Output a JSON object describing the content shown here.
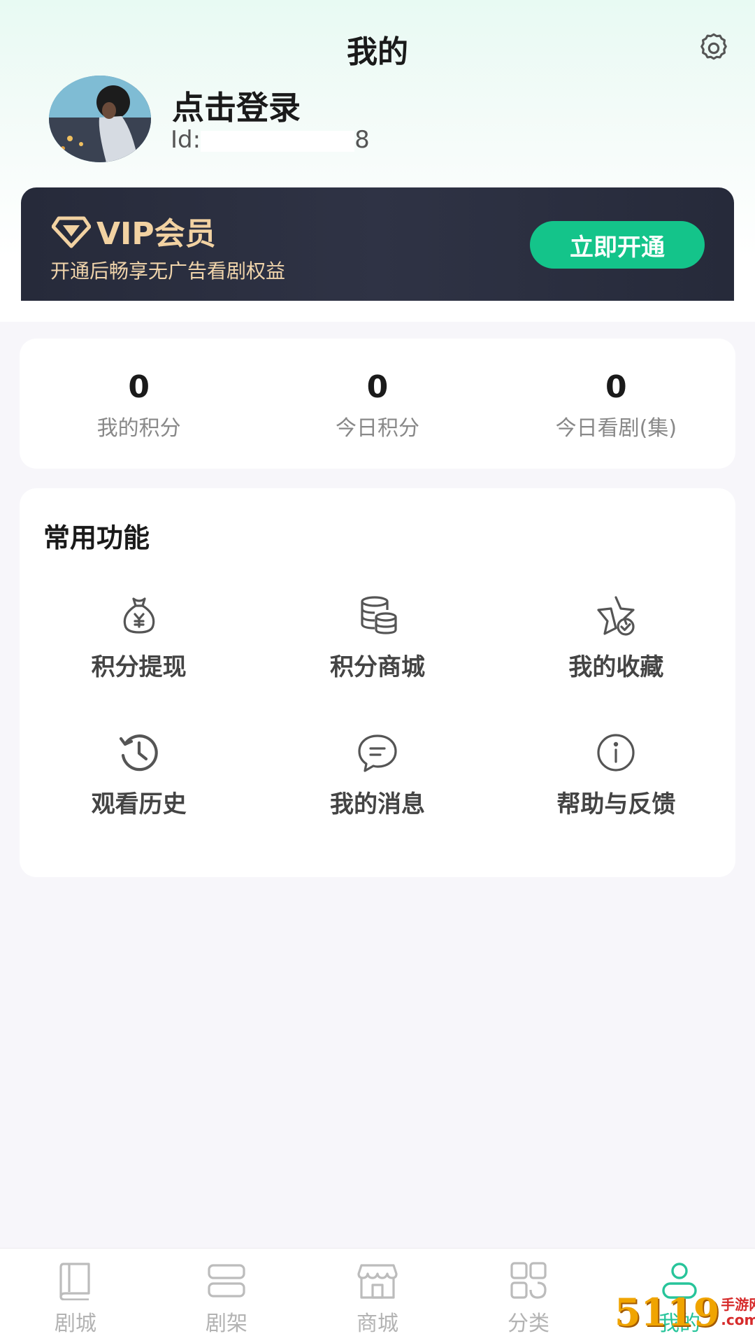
{
  "header": {
    "title": "我的",
    "settings_icon": "gear-icon"
  },
  "profile": {
    "login_text": "点击登录",
    "id_prefix": "Id:",
    "id_suffix": "8"
  },
  "vip": {
    "title": "VIP会员",
    "description": "开通后畅享无广告看剧权益",
    "button": "立即开通",
    "accent": "#14c48a"
  },
  "stats": [
    {
      "value": "0",
      "label": "我的积分"
    },
    {
      "value": "0",
      "label": "今日积分"
    },
    {
      "value": "0",
      "label": "今日看剧(集)"
    }
  ],
  "functions": {
    "title": "常用功能",
    "items": [
      {
        "label": "积分提现",
        "icon": "money-bag-icon"
      },
      {
        "label": "积分商城",
        "icon": "coins-stack-icon"
      },
      {
        "label": "我的收藏",
        "icon": "star-check-icon"
      },
      {
        "label": "观看历史",
        "icon": "history-icon"
      },
      {
        "label": "我的消息",
        "icon": "message-icon"
      },
      {
        "label": "帮助与反馈",
        "icon": "info-icon"
      }
    ]
  },
  "tabbar": {
    "items": [
      {
        "label": "剧城",
        "icon": "book-icon"
      },
      {
        "label": "剧架",
        "icon": "shelf-icon"
      },
      {
        "label": "商城",
        "icon": "store-icon"
      },
      {
        "label": "分类",
        "icon": "category-icon"
      },
      {
        "label": "我的",
        "icon": "user-icon",
        "active": true
      }
    ],
    "active_color": "#27c49a"
  },
  "watermark": {
    "num": "5119",
    "text1": "手游网",
    "text2": ".com.cn"
  }
}
